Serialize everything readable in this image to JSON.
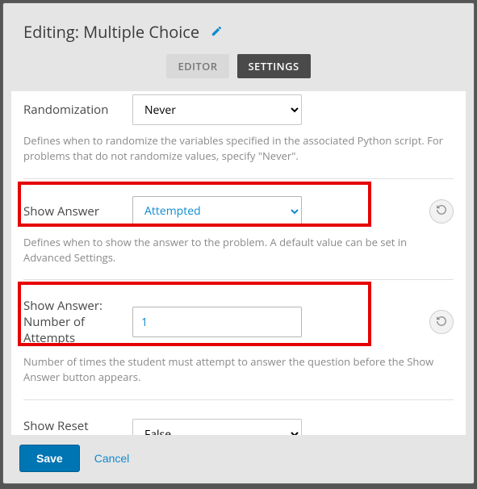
{
  "header": {
    "title": "Editing: Multiple Choice"
  },
  "tabs": {
    "editor": "EDITOR",
    "settings": "SETTINGS"
  },
  "settings": {
    "randomization": {
      "label": "Randomization",
      "value": "Never",
      "help": "Defines when to randomize the variables specified in the associated Python script. For problems that do not randomize values, specify \"Never\"."
    },
    "show_answer": {
      "label": "Show Answer",
      "value": "Attempted",
      "help": "Defines when to show the answer to the problem. A default value can be set in Advanced Settings."
    },
    "show_answer_attempts": {
      "label": "Show Answer: Number of Attempts",
      "value": "1",
      "help": "Number of times the student must attempt to answer the question before the Show Answer button appears."
    },
    "show_reset": {
      "label": "Show Reset Button",
      "value": "False"
    }
  },
  "footer": {
    "save": "Save",
    "cancel": "Cancel"
  }
}
